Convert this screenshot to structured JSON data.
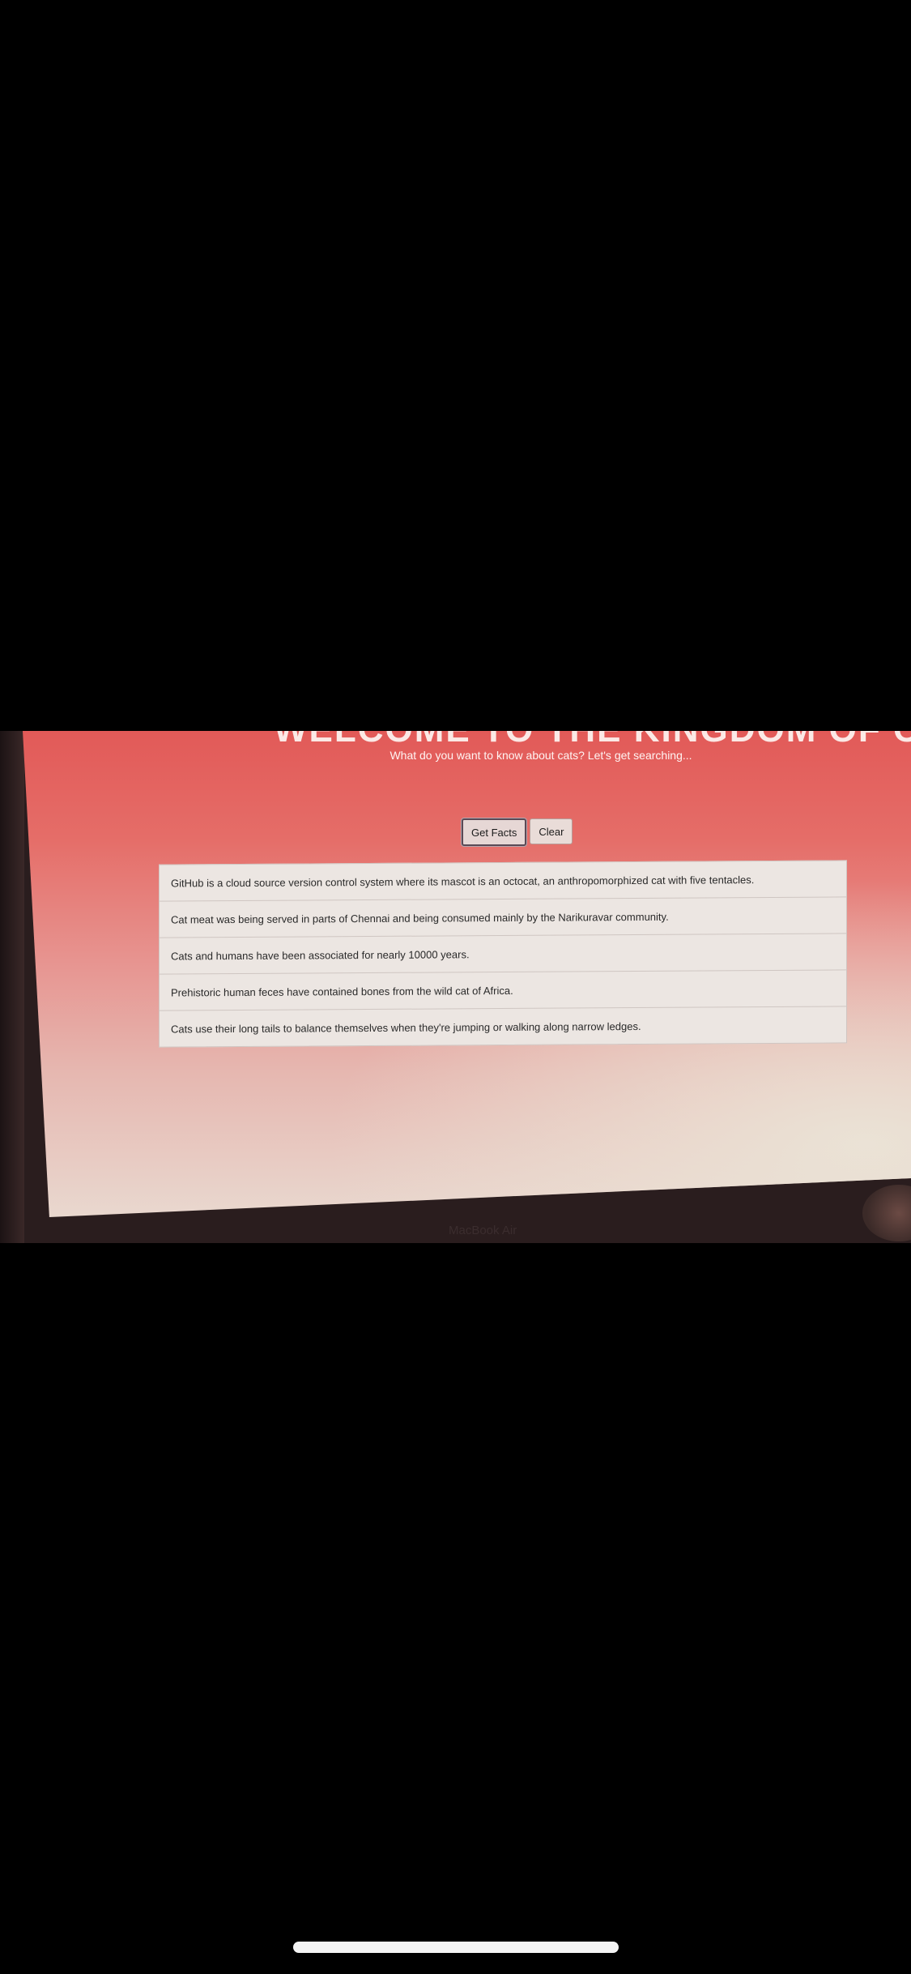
{
  "page": {
    "title_partial": "WELCOME TO THE KINGDOM OF CATS.",
    "subtitle": "What do you want to know about cats? Let's get searching..."
  },
  "buttons": {
    "get_facts": "Get Facts",
    "clear": "Clear"
  },
  "facts": [
    "GitHub is a cloud source version control system where its mascot is an octocat, an anthropomorphized cat with five tentacles.",
    "Cat meat was being served in parts of Chennai and being consumed mainly by the Narikuravar community.",
    "Cats and humans have been associated for nearly 10000 years.",
    "Prehistoric human feces have contained bones from the wild cat of Africa.",
    "Cats use their long tails to balance themselves when they're jumping or walking along narrow ledges."
  ],
  "device": {
    "laptop_label": "MacBook Air"
  },
  "colors": {
    "background_top": "#e25a58",
    "background_bottom": "#e9d8cf",
    "fact_panel": "#ece6e2"
  }
}
